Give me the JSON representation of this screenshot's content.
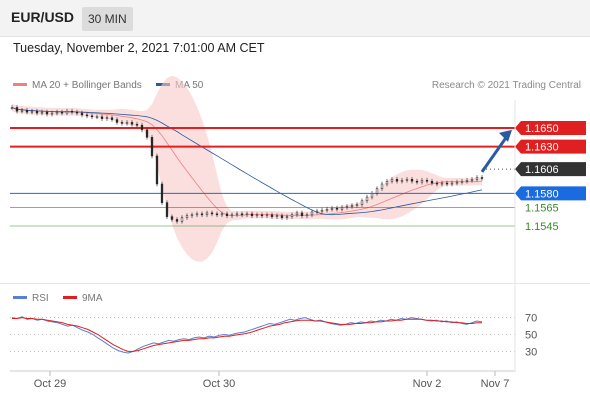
{
  "header": {
    "symbol": "EUR/USD",
    "timeframe": "30 MIN"
  },
  "datetime": "Tuesday, November 2, 2021 7:01:00 AM CET",
  "legend": {
    "items": [
      {
        "label": "MA 20 + Bollinger Bands",
        "color": "#f08080"
      },
      {
        "label": "MA 50",
        "color": "#2a5a9a"
      }
    ],
    "credit": "Research © 2021 Trading Central"
  },
  "rsi_legend": {
    "items": [
      {
        "label": "RSI",
        "color": "#5b7fd6"
      },
      {
        "label": "9MA",
        "color": "#e02020"
      }
    ]
  },
  "chart_data": [
    {
      "type": "candlestick",
      "title": "",
      "ylim": [
        1.15,
        1.168
      ],
      "x_ticks": [
        "Oct 29",
        "Oct 30",
        "Nov 2",
        "Nov 7"
      ],
      "close": [
        1.1672,
        1.1668,
        1.1669,
        1.1667,
        1.1668,
        1.1666,
        1.1667,
        1.1665,
        1.1666,
        1.1667,
        1.1666,
        1.1668,
        1.1667,
        1.1666,
        1.1664,
        1.1663,
        1.1662,
        1.1662,
        1.166,
        1.1661,
        1.1659,
        1.1656,
        1.1655,
        1.1656,
        1.1654,
        1.1653,
        1.1648,
        1.164,
        1.162,
        1.159,
        1.157,
        1.1555,
        1.1552,
        1.155,
        1.1554,
        1.1556,
        1.1557,
        1.1558,
        1.1557,
        1.1559,
        1.1558,
        1.1557,
        1.1558,
        1.1556,
        1.1557,
        1.1558,
        1.1557,
        1.1558,
        1.1556,
        1.1557,
        1.1556,
        1.1557,
        1.1555,
        1.1556,
        1.1554,
        1.1555,
        1.1557,
        1.1559,
        1.1556,
        1.1557,
        1.156,
        1.1561,
        1.1562,
        1.1563,
        1.1564,
        1.1563,
        1.1565,
        1.1566,
        1.1567,
        1.1568,
        1.1572,
        1.1576,
        1.158,
        1.1585,
        1.159,
        1.1593,
        1.1595,
        1.1593,
        1.1594,
        1.1595,
        1.1593,
        1.1592,
        1.1594,
        1.1593,
        1.1591,
        1.159,
        1.1591,
        1.159,
        1.1591,
        1.1592,
        1.1593,
        1.1594,
        1.1595,
        1.1597,
        1.1596
      ],
      "current_price": "1.1606",
      "levels": [
        {
          "value": 1.165,
          "label": "1.1650",
          "kind": "resistance"
        },
        {
          "value": 1.163,
          "label": "1.1630",
          "kind": "resistance"
        },
        {
          "value": 1.158,
          "label": "1.1580",
          "kind": "pivot"
        },
        {
          "value": 1.1565,
          "label": "1.1565",
          "kind": "support"
        },
        {
          "value": 1.1545,
          "label": "1.1545",
          "kind": "support"
        }
      ],
      "colors": {
        "resistance": "#e02020",
        "pivot": "#1a6ae0",
        "support": "#3a8a2a",
        "current": "#333333",
        "arrow": "#2a5aa0",
        "bands": "#f9c8c8",
        "ma20": "#f08080",
        "ma50": "#2a5a9a",
        "candle": "#222222"
      }
    },
    {
      "type": "line",
      "title": "RSI",
      "ylim": [
        15,
        85
      ],
      "y_ticks": [
        "70",
        "50",
        "30"
      ],
      "series": [
        {
          "name": "RSI",
          "color": "#5b7fd6",
          "values": [
            70,
            69,
            71,
            68,
            69,
            67,
            68,
            66,
            65,
            64,
            62,
            60,
            61,
            58,
            55,
            53,
            50,
            46,
            42,
            38,
            34,
            31,
            29,
            28,
            30,
            33,
            36,
            38,
            40,
            39,
            41,
            43,
            42,
            44,
            45,
            44,
            46,
            47,
            46,
            48,
            47,
            49,
            50,
            49,
            51,
            52,
            53,
            55,
            57,
            59,
            61,
            63,
            62,
            64,
            66,
            68,
            67,
            69,
            70,
            68,
            66,
            67,
            65,
            63,
            62,
            61,
            62,
            64,
            63,
            65,
            64,
            66,
            65,
            67,
            66,
            68,
            67,
            69,
            68,
            70,
            69,
            68,
            67,
            66,
            67,
            65,
            66,
            64,
            65,
            63,
            62,
            64,
            66,
            65
          ]
        },
        {
          "name": "9MA",
          "color": "#e02020",
          "values": [
            69,
            69,
            70,
            69,
            69,
            68,
            68,
            67,
            66,
            65,
            64,
            62,
            61,
            60,
            58,
            56,
            53,
            50,
            46,
            42,
            38,
            35,
            32,
            30,
            30,
            31,
            33,
            35,
            37,
            38,
            39,
            40,
            41,
            42,
            43,
            43,
            44,
            45,
            45,
            46,
            46,
            47,
            48,
            48,
            49,
            50,
            51,
            52,
            54,
            56,
            58,
            60,
            61,
            62,
            64,
            65,
            66,
            67,
            67,
            67,
            66,
            66,
            65,
            64,
            63,
            62,
            62,
            62,
            63,
            63,
            64,
            64,
            65,
            65,
            66,
            66,
            67,
            67,
            68,
            68,
            68,
            68,
            67,
            67,
            66,
            66,
            65,
            65,
            64,
            64,
            63,
            63,
            64,
            64
          ]
        }
      ]
    }
  ]
}
